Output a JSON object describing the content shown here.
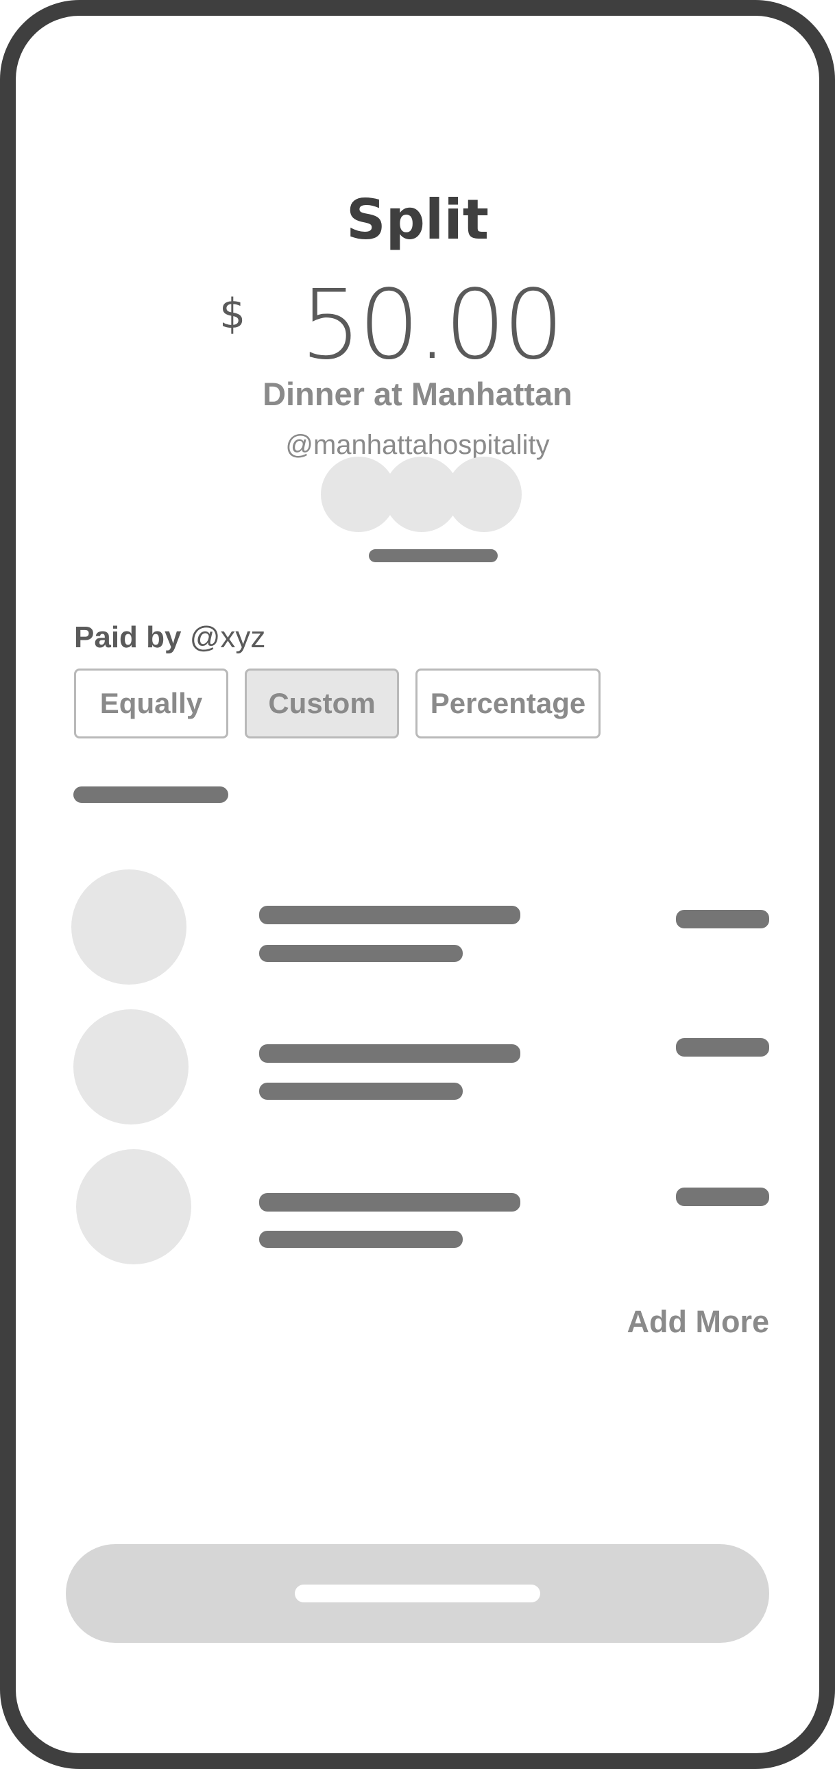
{
  "header": {
    "title": "Split",
    "currency_symbol": "$",
    "amount": "50.00",
    "description": "Dinner at Manhattan",
    "merchant_handle": "@manhattahospitality"
  },
  "paid_by": {
    "label": "Paid by",
    "handle": "@xyz"
  },
  "split_options": [
    {
      "label": "Equally",
      "selected": false
    },
    {
      "label": "Custom",
      "selected": true
    },
    {
      "label": "Percentage",
      "selected": false
    }
  ],
  "add_more_label": "Add More",
  "colors": {
    "frame": "#3f3f3f",
    "placeholder_bar": "#757575",
    "placeholder_circle": "#e6e6e6",
    "button_fill": "#d6d6d6",
    "muted_text": "#8a8a8a"
  }
}
